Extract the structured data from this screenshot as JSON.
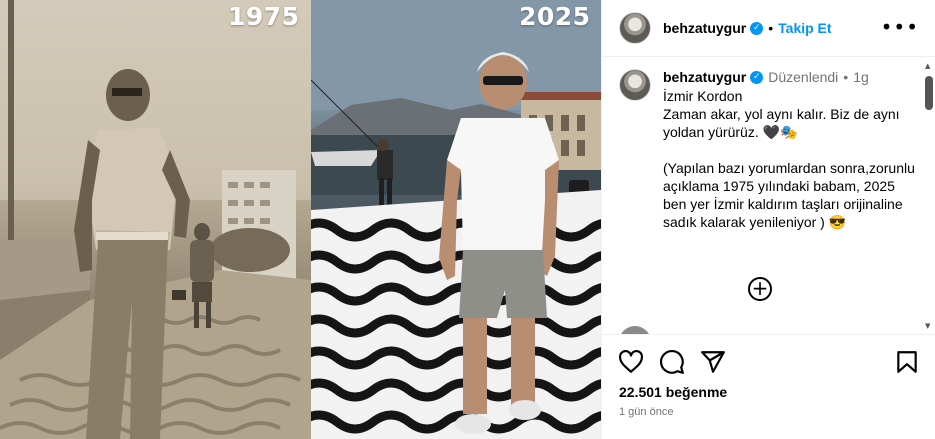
{
  "media": {
    "left_year": "1975",
    "right_year": "2025"
  },
  "header": {
    "username": "behzatuygur",
    "separator": "•",
    "follow_label": "Takip Et",
    "more_label": "•••"
  },
  "caption": {
    "username": "behzatuygur",
    "edited_label": "Düzenlendi",
    "separator": "•",
    "age": "1g",
    "text": "İzmir Kordon\nZaman akar, yol aynı kalır. Biz de aynı yoldan yürürüz. 🖤🎭\n\n (Yapılan bazı yorumlardan sonra,zorunlu açıklama 1975 yılındaki babam, 2025 ben yer İzmir kaldırım taşları orijinaline sadık kalarak yenileniyor ) 😎"
  },
  "comments": {
    "load_more_label": "+"
  },
  "footer": {
    "likes": "22.501 beğenme",
    "time_ago": "1 gün önce"
  },
  "icons": {
    "like": "heart-icon",
    "comment": "comment-icon",
    "share": "share-icon",
    "save": "bookmark-icon",
    "verified": "verified-badge-icon"
  },
  "colors": {
    "accent": "#0095f6",
    "muted": "#737373",
    "divider": "#efefef"
  }
}
